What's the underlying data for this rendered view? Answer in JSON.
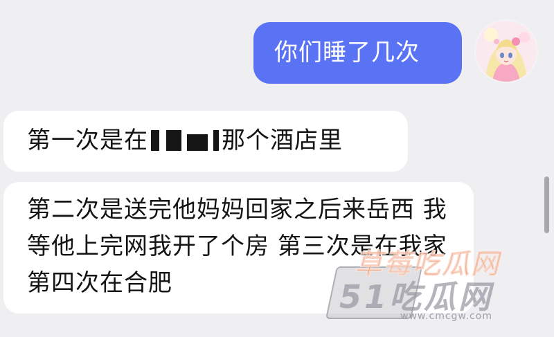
{
  "messages": [
    {
      "side": "outgoing",
      "text": "你们睡了几次"
    },
    {
      "side": "incoming",
      "text_before": "第一次是在",
      "text_after": "那个酒店里"
    },
    {
      "side": "incoming",
      "text": "第二次是送完他妈妈回家之后来岳西 我等他上完网我开了个房 第三次是在我家 第四次在合肥"
    }
  ],
  "watermark": {
    "title": "草莓吃瓜网",
    "code": "51吃瓜网",
    "url": "www.cmcgw.com"
  },
  "colors": {
    "background": "#efeff1",
    "outgoing_bubble": "#5a73f5",
    "incoming_bubble": "#ffffff",
    "text": "#141414"
  }
}
